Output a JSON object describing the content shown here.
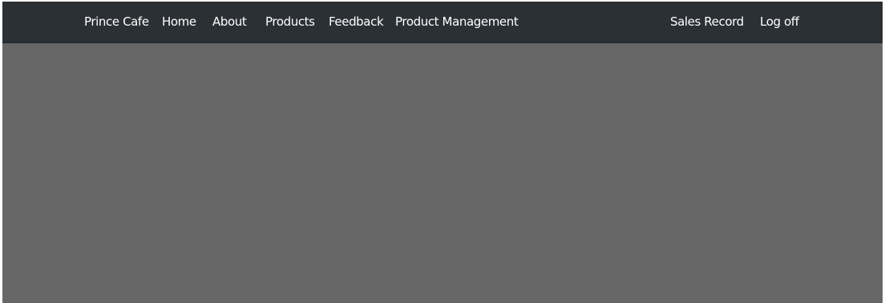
{
  "navbar": {
    "brand": "Prince Cafe",
    "left_items": [
      {
        "label": "Home"
      },
      {
        "label": "About"
      },
      {
        "label": "Products"
      },
      {
        "label": "Feedback"
      },
      {
        "label": "Product Management"
      }
    ],
    "right_items": [
      {
        "label": "Sales Record"
      },
      {
        "label": "Log off"
      }
    ]
  },
  "colors": {
    "navbar_background": "#2b3035",
    "nav_text": "#ffffff",
    "content_background": "#676767"
  }
}
